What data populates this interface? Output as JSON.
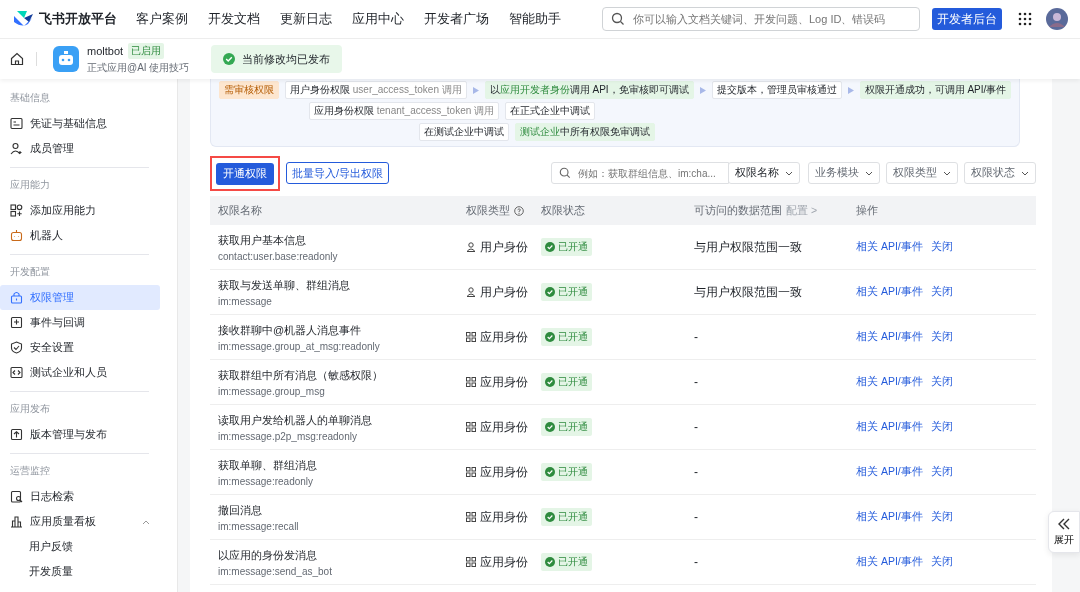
{
  "topnav": {
    "brand": "飞书开放平台",
    "links": [
      "客户案例",
      "开发文档",
      "更新日志",
      "应用中心",
      "开发者广场",
      "智能助手"
    ],
    "search": {
      "placeholder": "你可以输入文档关键词、开发问题、Log ID、错误码"
    },
    "console_button": "开发者后台"
  },
  "app_header": {
    "name": "moltbot",
    "badge": "已启用",
    "subtitle": "正式应用@AI 使用技巧",
    "notice": "当前修改均已发布"
  },
  "sidebar": {
    "groups": [
      {
        "title": "基础信息",
        "items": [
          {
            "label": "凭证与基础信息",
            "kind": "card",
            "selected": false
          },
          {
            "label": "成员管理",
            "kind": "user",
            "selected": false
          }
        ]
      },
      {
        "title": "应用能力",
        "items": [
          {
            "label": "添加应用能力",
            "kind": "grid",
            "selected": false
          },
          {
            "label": "机器人",
            "kind": "robot",
            "selected": false
          }
        ]
      },
      {
        "title": "开发配置",
        "items": [
          {
            "label": "权限管理",
            "kind": "lock",
            "selected": true
          },
          {
            "label": "事件与回调",
            "kind": "event",
            "selected": false
          },
          {
            "label": "安全设置",
            "kind": "shield",
            "selected": false
          },
          {
            "label": "测试企业和人员",
            "kind": "code",
            "selected": false
          }
        ]
      },
      {
        "title": "应用发布",
        "items": [
          {
            "label": "版本管理与发布",
            "kind": "upload",
            "selected": false
          }
        ]
      },
      {
        "title": "运营监控",
        "items": [
          {
            "label": "日志检索",
            "kind": "log",
            "selected": false
          },
          {
            "label": "应用质量看板",
            "kind": "chart",
            "selected": false,
            "expanded": true,
            "children": [
              {
                "label": "用户反馈"
              },
              {
                "label": "开发质量"
              }
            ]
          }
        ]
      }
    ]
  },
  "flow": {
    "review_tag": "需审核权限",
    "user_token": {
      "label": "用户身份权限",
      "token": "user_access_token",
      "suffix": "调用"
    },
    "dev_debug": {
      "lead": "以",
      "highlight": "应用开发者身份",
      "tail": "调用 API，免审核即可调试"
    },
    "submit": "提交版本，管理员审核通过",
    "success": "权限开通成功，可调用 API/事件",
    "app_token": {
      "label": "应用身份权限",
      "token": "tenant_access_token",
      "suffix": "调用"
    },
    "prod_debug": "在正式企业中调试",
    "test_debug": "在测试企业中调试",
    "test_free": {
      "highlight": "测试企业",
      "tail": "中所有权限免审调试"
    }
  },
  "toolbar": {
    "primary": "开通权限",
    "secondary": "批量导入/导出权限",
    "search": {
      "placeholder": "例如：获取群组信息、im:cha..."
    },
    "search_field": "权限名称",
    "filters": [
      "业务模块",
      "权限类型",
      "权限状态"
    ]
  },
  "table": {
    "columns": [
      {
        "label": "权限名称"
      },
      {
        "label": "权限类型",
        "help": true
      },
      {
        "label": "权限状态"
      },
      {
        "label": "可访问的数据范围",
        "link": "配置 >"
      },
      {
        "label": "操作"
      }
    ],
    "rows": [
      {
        "name": "获取用户基本信息",
        "scope": "contact:user.base:readonly",
        "type": {
          "kind": "user",
          "label": "用户身份"
        },
        "status": "已开通",
        "range": "与用户权限范围一致",
        "actions": [
          "相关 API/事件",
          "关闭"
        ]
      },
      {
        "name": "获取与发送单聊、群组消息",
        "scope": "im:message",
        "type": {
          "kind": "user",
          "label": "用户身份"
        },
        "status": "已开通",
        "range": "与用户权限范围一致",
        "actions": [
          "相关 API/事件",
          "关闭"
        ]
      },
      {
        "name": "接收群聊中@机器人消息事件",
        "scope": "im:message.group_at_msg:readonly",
        "type": {
          "kind": "app",
          "label": "应用身份"
        },
        "status": "已开通",
        "range": "-",
        "actions": [
          "相关 API/事件",
          "关闭"
        ]
      },
      {
        "name": "获取群组中所有消息（敏感权限）",
        "scope": "im:message.group_msg",
        "type": {
          "kind": "app",
          "label": "应用身份"
        },
        "status": "已开通",
        "range": "-",
        "actions": [
          "相关 API/事件",
          "关闭"
        ]
      },
      {
        "name": "读取用户发给机器人的单聊消息",
        "scope": "im:message.p2p_msg:readonly",
        "type": {
          "kind": "app",
          "label": "应用身份"
        },
        "status": "已开通",
        "range": "-",
        "actions": [
          "相关 API/事件",
          "关闭"
        ]
      },
      {
        "name": "获取单聊、群组消息",
        "scope": "im:message:readonly",
        "type": {
          "kind": "app",
          "label": "应用身份"
        },
        "status": "已开通",
        "range": "-",
        "actions": [
          "相关 API/事件",
          "关闭"
        ]
      },
      {
        "name": "撤回消息",
        "scope": "im:message:recall",
        "type": {
          "kind": "app",
          "label": "应用身份"
        },
        "status": "已开通",
        "range": "-",
        "actions": [
          "相关 API/事件",
          "关闭"
        ]
      },
      {
        "name": "以应用的身份发消息",
        "scope": "im:message:send_as_bot",
        "type": {
          "kind": "app",
          "label": "应用身份"
        },
        "status": "已开通",
        "range": "-",
        "actions": [
          "相关 API/事件",
          "关闭"
        ]
      }
    ]
  },
  "expand_button": "展开"
}
